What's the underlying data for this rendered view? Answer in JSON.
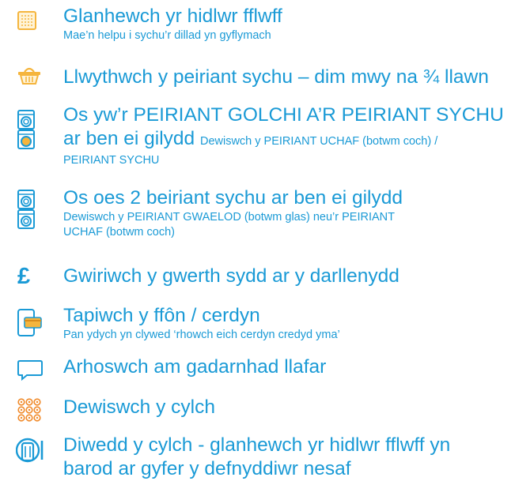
{
  "colors": {
    "primary": "#1a9ad6",
    "yellow": "#f5b53d",
    "orange": "#f08a2a"
  },
  "steps": [
    {
      "icon": "lint-filter-icon",
      "title": "Glanhewch yr hidlwr fflwff",
      "detail": "Mae’n helpu i sychu’r dillad yn gyflymach"
    },
    {
      "icon": "laundry-basket-icon",
      "title": "Llwythwch y peiriant sychu – dim mwy na ¾ llawn"
    },
    {
      "icon": "stacked-washer-dryer-icon",
      "title": "Os yw’r PEIRIANT GOLCHI A’R PEIRIANT SYCHU",
      "title2": "ar ben ei gilydd",
      "detail_inline": "Dewiswch y PEIRIANT UCHAF (botwm coch) /",
      "detail": "PEIRIANT SYCHU"
    },
    {
      "icon": "stacked-dryers-icon",
      "title": "Os oes 2 beiriant sychu ar ben ei gilydd",
      "detail": "Dewiswch y PEIRIANT GWAELOD (botwm glas) neu’r PEIRIANT",
      "detail2": "UCHAF (botwm coch)"
    },
    {
      "icon": "pound-icon",
      "title": "Gwiriwch y gwerth sydd ar y darllenydd"
    },
    {
      "icon": "phone-card-icon",
      "title": "Tapiwch y ffôn / cerdyn",
      "detail": "Pan ydych yn clywed ‘rhowch eich cerdyn credyd yma’"
    },
    {
      "icon": "speech-bubble-icon",
      "title": "Arhoswch am gadarnhad llafar"
    },
    {
      "icon": "keypad-icon",
      "title": "Dewiswch y cylch"
    },
    {
      "icon": "drum-filter-icon",
      "title": "Diwedd y cylch - glanhewch yr hidlwr fflwff yn",
      "title2": "barod ar gyfer y defnyddiwr nesaf"
    }
  ]
}
